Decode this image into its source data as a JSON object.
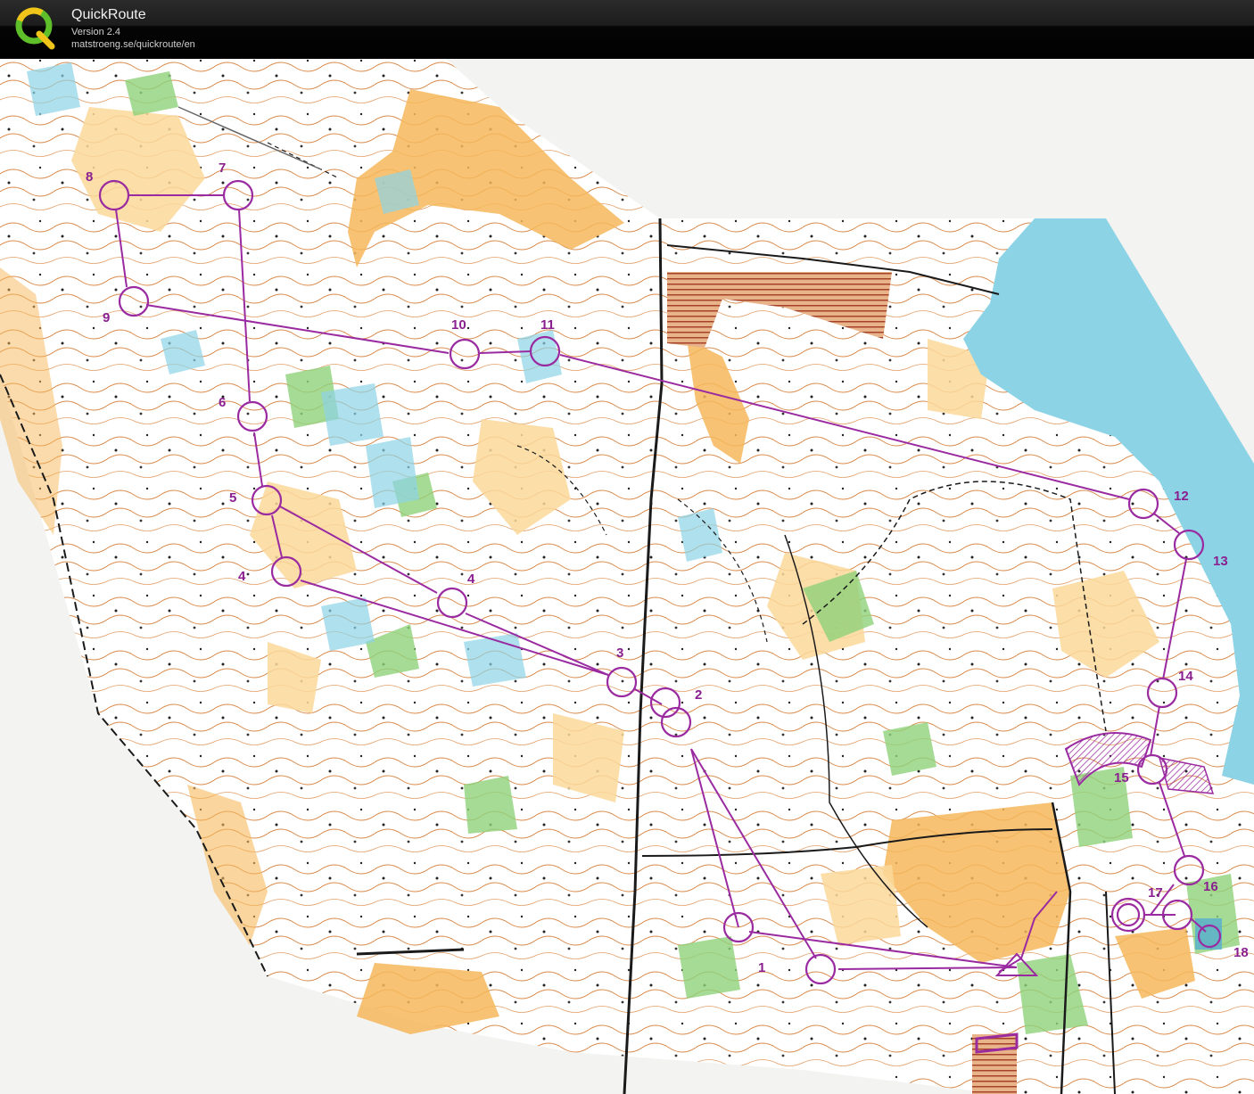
{
  "app": {
    "title": "QuickRoute",
    "version": "Version 2.4",
    "url": "matstroeng.se/quickroute/en"
  },
  "colors": {
    "course": "#9a2aa0",
    "label": "#8a1f8f",
    "forest": "#ffffff",
    "open": "#f6b85a",
    "rough_open": "#fbd89a",
    "green": "#8fd27a",
    "water": "#8dd3e6",
    "contour": "#c9772e"
  },
  "course": {
    "controls": [
      {
        "label": "1"
      },
      {
        "label": "2"
      },
      {
        "label": "3"
      },
      {
        "label": "4"
      },
      {
        "label": "5"
      },
      {
        "label": "6"
      },
      {
        "label": "7"
      },
      {
        "label": "8"
      },
      {
        "label": "9"
      },
      {
        "label": "10"
      },
      {
        "label": "11"
      },
      {
        "label": "12"
      },
      {
        "label": "13"
      },
      {
        "label": "14"
      },
      {
        "label": "15"
      },
      {
        "label": "16"
      },
      {
        "label": "17"
      },
      {
        "label": "18"
      }
    ],
    "extra_labels": [
      {
        "label": "4"
      },
      {
        "label": "4"
      }
    ]
  }
}
